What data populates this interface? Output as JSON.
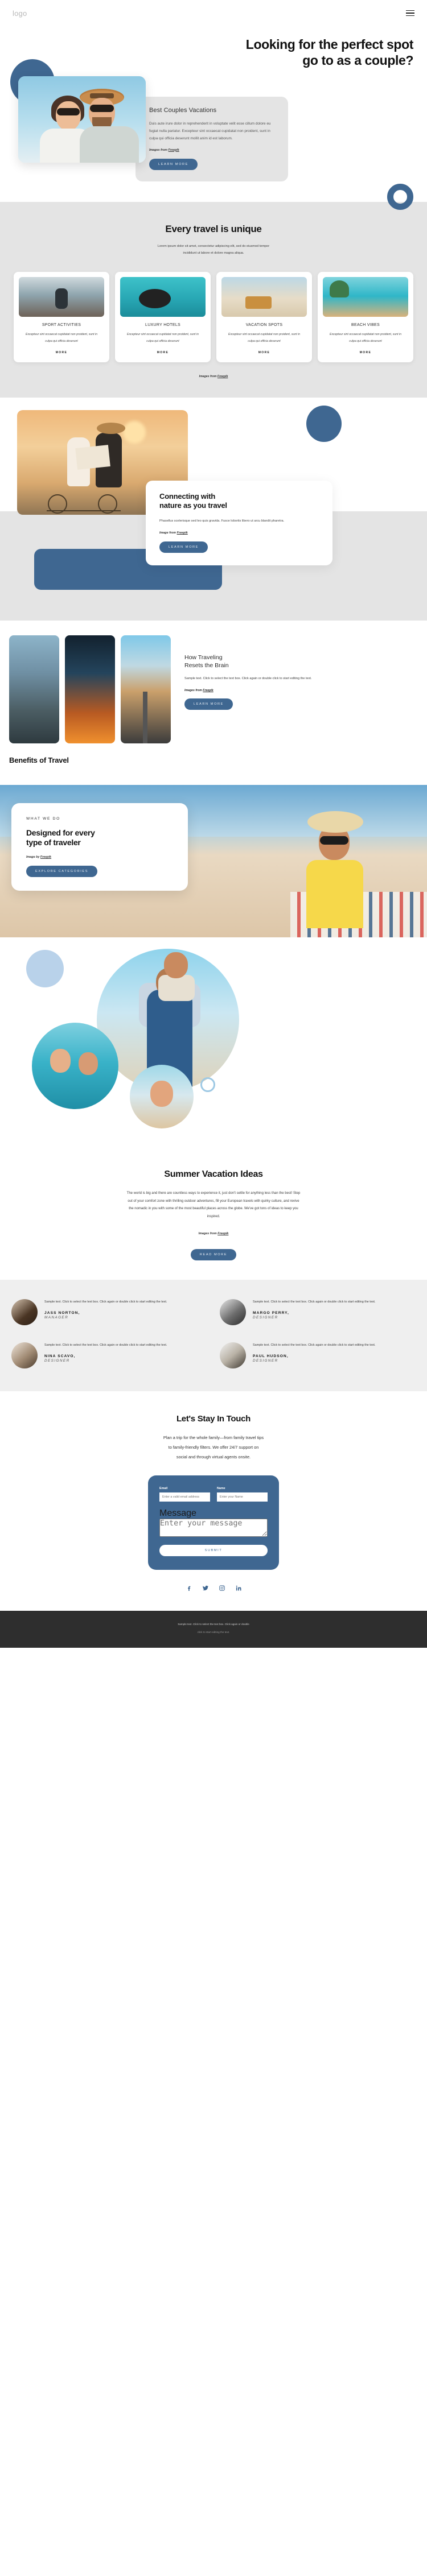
{
  "header": {
    "logo": "logo",
    "menu_icon": "hamburger-menu-icon"
  },
  "hero": {
    "title_line1": "Looking for the perfect spot",
    "title_line2": "go to as a couple?",
    "card": {
      "title": "Best Couples Vacations",
      "body": "Duis aute irure dolor in reprehenderit in voluptate velit esse cillum dolore eu fugiat nulla pariatur. Excepteur sint occaecat cupidatat non proident, sunt in culpa qui officia deserunt mollit anim id est laborum.",
      "credit_prefix": "Images from ",
      "credit_link": "Freepik",
      "button": "LEARN MORE"
    }
  },
  "unique": {
    "title": "Every travel is unique",
    "subtitle_line1": "Lorem ipsum dolor sit amet, consectetur adipiscing elit, sed do eiusmod tempor",
    "subtitle_line2": "incididunt ut labore et dolore magna aliqua.",
    "cards": [
      {
        "title": "SPORT ACTIVITIES",
        "body": "Excepteur sint occaecat cupidatat non proident, sunt in culpa qui officia deserunt",
        "more": "MORE"
      },
      {
        "title": "LUXURY HOTELS",
        "body": "Excepteur sint occaecat cupidatat non proident, sunt in culpa qui officia deserunt",
        "more": "MORE"
      },
      {
        "title": "VACATION SPOTS",
        "body": "Excepteur sint occaecat cupidatat non proident, sunt in culpa qui officia deserunt",
        "more": "MORE"
      },
      {
        "title": "BEACH VIBES",
        "body": "Excepteur sint occaecat cupidatat non proident, sunt in culpa qui officia deserunt",
        "more": "MORE"
      }
    ],
    "credit_prefix": "Images from ",
    "credit_link": "Freepik"
  },
  "connect": {
    "title_line1": "Connecting with",
    "title_line2": "nature as you travel",
    "body": "Phasellus scelerisque sed leo quis gravida. Fusce lobortis libero ut arcu blandit pharetra.",
    "credit_prefix": "Image from ",
    "credit_link": "Freepik",
    "button": "LEARN MORE"
  },
  "brain": {
    "title_line1": "How Traveling",
    "title_line2": "Resets the Brain",
    "body": "Sample text. Click to select the text box. Click again or double click to start editing the text.",
    "credit_prefix": "Images from ",
    "credit_link": "Freepik",
    "button": "LEARN MORE",
    "section_heading": "Benefits of Travel"
  },
  "designed": {
    "eyebrow": "WHAT WE DO",
    "title_line1": "Designed for every",
    "title_line2": "type of traveler",
    "credit_prefix": "Image by ",
    "credit_link": "Freepik",
    "button": "EXPLORE CATEGORIES"
  },
  "summer": {
    "title": "Summer Vacation Ideas",
    "body": "The world is big and there are countless ways to experience it, just don't settle for anything less than the best! Step out of your comfort zone with thrilling outdoor adventures, fill your European travels with quirky culture, and revive the nomadic in you with some of the most beautiful places across the globe. We've got tons of ideas to keep you inspired.",
    "credit_prefix": "Images from ",
    "credit_link": "Freepik",
    "button": "READ MORE"
  },
  "testimonials": [
    {
      "quote": "Sample text. Click to select the text box. Click again or double click to start editing the text.",
      "name": "JASS NORTON,",
      "role": "MANAGER"
    },
    {
      "quote": "Sample text. Click to select the text box. Click again or double click to start editing the text.",
      "name": "MARGO PERRY,",
      "role": "DESIGNER"
    },
    {
      "quote": "Sample text. Click to select the text box. Click again or double click to start editing the text.",
      "name": "NINA SCAVO,",
      "role": "DESIGNER"
    },
    {
      "quote": "Sample text. Click to select the text box. Click again or double click to start editing the text.",
      "name": "PAUL HUDSON,",
      "role": "DESIGNER"
    }
  ],
  "touch": {
    "title": "Let's Stay In Touch",
    "lead_line1": "Plan a trip for the whole family—from family travel tips",
    "lead_line2": "to family-friendly filters. We offer 24/7 support on",
    "lead_line3": "social and through virtual agents onsite.",
    "form": {
      "email_label": "Email",
      "email_placeholder": "Enter a valid email address",
      "email_value": "",
      "name_label": "Name",
      "name_placeholder": "Enter your Name",
      "name_value": "",
      "message_label": "Message",
      "message_placeholder": "Enter your message",
      "message_value": "",
      "submit": "SUBMIT"
    },
    "social": [
      "facebook-icon",
      "twitter-icon",
      "instagram-icon",
      "linkedin-icon"
    ]
  },
  "footer": {
    "line1": "Sample text. Click to select the text box. Click again or double",
    "line2": "click to start editing the text."
  },
  "colors": {
    "accent": "#3f6791",
    "grey_bg": "#e4e4e4",
    "testi_bg": "#efefef",
    "footer_bg": "#2e2e2e"
  }
}
